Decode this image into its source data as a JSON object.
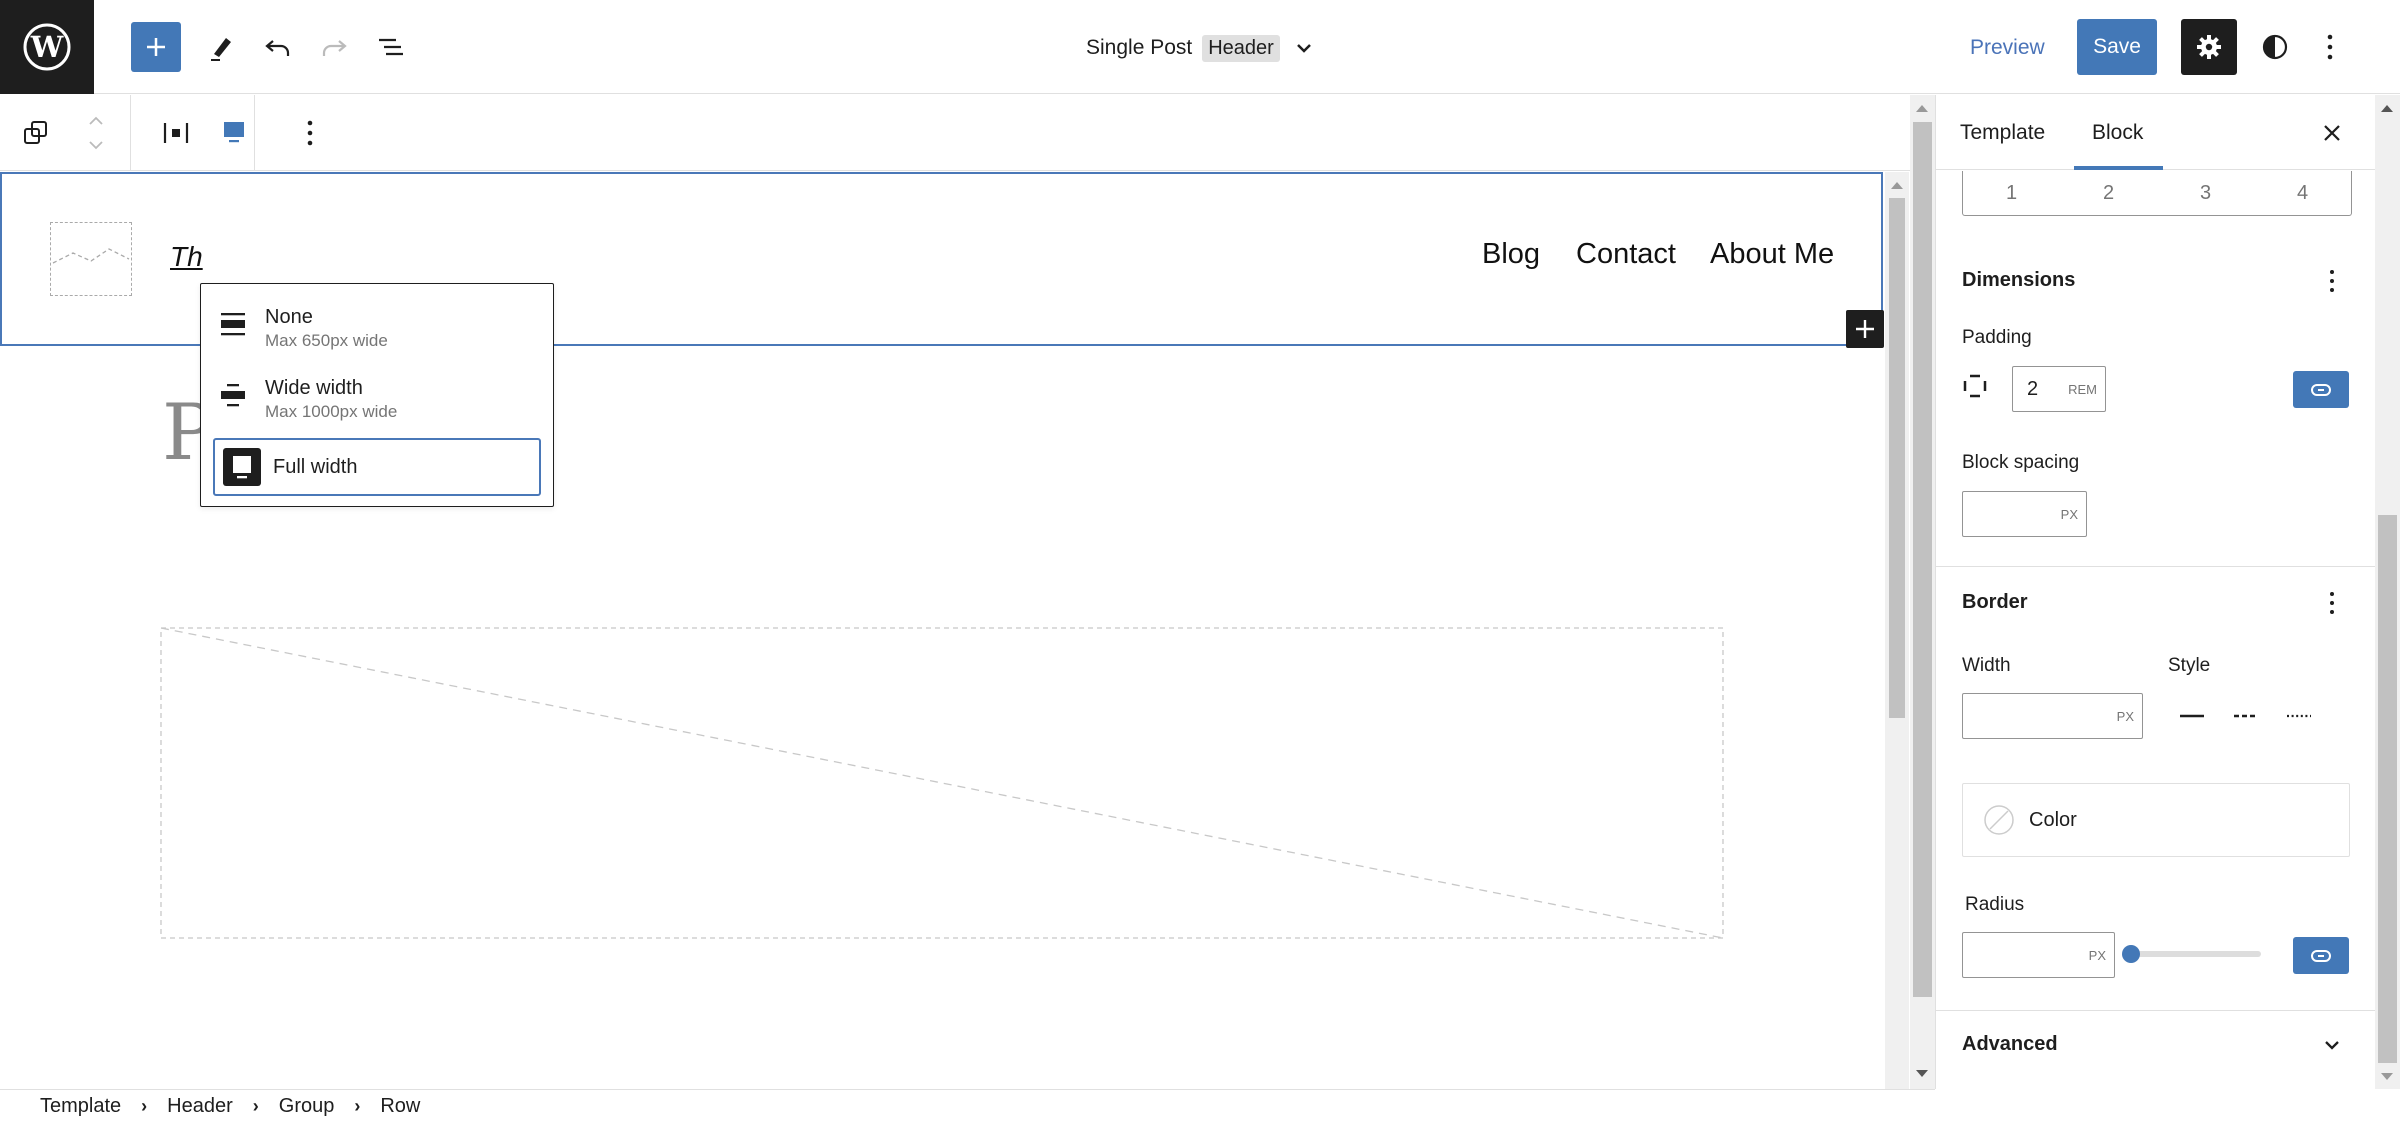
{
  "topbar": {
    "add_block_label": "Add block",
    "document_title": "Single Post",
    "document_badge": "Header",
    "preview_label": "Preview",
    "save_label": "Save",
    "colors": {
      "accent": "#4378b7",
      "dark": "#1e1e1e"
    }
  },
  "block_toolbar": {
    "items": [
      "select-parent",
      "move-up-down",
      "justify",
      "align",
      "more-options"
    ]
  },
  "canvas": {
    "site_title": "Th",
    "nav": [
      "Blog",
      "Contact",
      "About Me"
    ],
    "post_title": "Post Title"
  },
  "align_menu": {
    "items": [
      {
        "label": "None",
        "desc": "Max 650px wide",
        "selected": false
      },
      {
        "label": "Wide width",
        "desc": "Max 1000px wide",
        "selected": false
      },
      {
        "label": "Full width",
        "desc": "",
        "selected": true
      }
    ]
  },
  "breadcrumb": [
    "Template",
    "Header",
    "Group",
    "Row"
  ],
  "sidebar": {
    "tabs": [
      {
        "label": "Template",
        "active": false
      },
      {
        "label": "Block",
        "active": true
      }
    ],
    "columns": [
      "1",
      "2",
      "3",
      "4"
    ],
    "dimensions": {
      "title": "Dimensions",
      "padding_label": "Padding",
      "padding_value": "2",
      "padding_unit": "REM",
      "block_spacing_label": "Block spacing",
      "block_spacing_value": "",
      "block_spacing_unit": "PX"
    },
    "border": {
      "title": "Border",
      "width_label": "Width",
      "width_value": "",
      "width_unit": "PX",
      "style_label": "Style",
      "styles": [
        "solid",
        "dashed",
        "dotted"
      ],
      "color_label": "Color",
      "radius_label": "Radius",
      "radius_value": "",
      "radius_unit": "PX",
      "radius_slider": 0
    },
    "advanced": {
      "title": "Advanced"
    }
  }
}
